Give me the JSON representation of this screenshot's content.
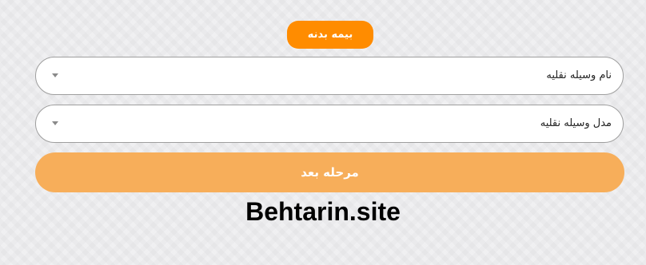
{
  "form": {
    "badge_label": "بیمه بدنه",
    "vehicle_name_select": {
      "placeholder": "نام وسیله نقلیه",
      "icon": "chevron-down-icon"
    },
    "vehicle_model_select": {
      "placeholder": "مدل وسیله نقلیه",
      "icon": "chevron-down-icon"
    },
    "next_button_label": "مرحله بعد"
  },
  "watermark": "Behtarin.site",
  "colors": {
    "badge": "#ff8c00",
    "next_button": "#f7ae5a",
    "background": "#eeeef0"
  }
}
